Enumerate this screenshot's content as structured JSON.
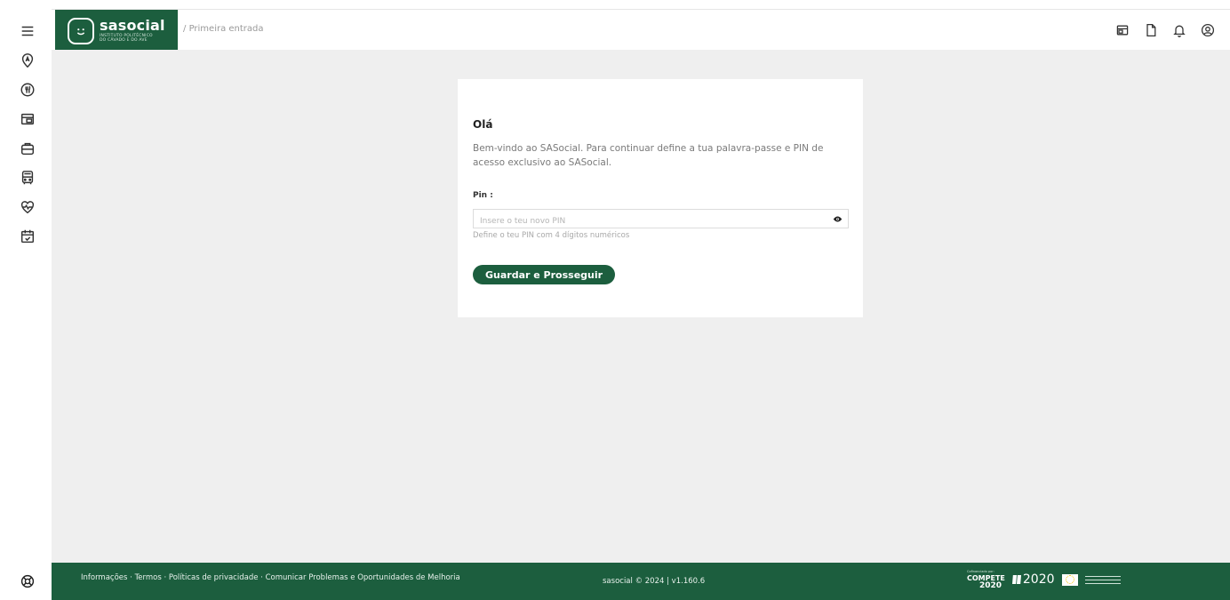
{
  "brand": {
    "name": "sasocial",
    "subtitle_line1": "INSTITUTO POLITÉCNICO",
    "subtitle_line2": "DO CÁVADO E DO AVE",
    "color": "#1c5e3e"
  },
  "breadcrumb": {
    "separator": "/",
    "current": "Primeira entrada"
  },
  "sidebar": {
    "items": [
      {
        "icon": "menu-icon"
      },
      {
        "icon": "accommodation-icon"
      },
      {
        "icon": "food-icon"
      },
      {
        "icon": "wallet-icon"
      },
      {
        "icon": "briefcase-icon"
      },
      {
        "icon": "bus-icon"
      },
      {
        "icon": "health-icon"
      },
      {
        "icon": "calendar-check-icon"
      }
    ]
  },
  "top_actions": [
    {
      "icon": "card-icon"
    },
    {
      "icon": "document-icon"
    },
    {
      "icon": "bell-icon"
    },
    {
      "icon": "user-circle-icon"
    }
  ],
  "card": {
    "title": "Olá",
    "text": "Bem-vindo ao SASocial. Para continuar define a tua palavra-passe e PIN de acesso exclusivo ao SASocial.",
    "pin_label": "Pin :",
    "pin_value": "",
    "pin_placeholder": "Insere o teu novo PIN",
    "pin_hint": "Define o teu PIN com 4 dígitos numéricos",
    "submit_label": "Guardar e Prosseguir"
  },
  "footer": {
    "links": [
      "Informações",
      "Termos",
      "Políticas de privacidade",
      "Comunicar Problemas e Oportunidades de Melhoria"
    ],
    "link_separator": " · ",
    "copyright": "sasocial © 2024 | v1.160.6",
    "logos": {
      "cofinanced_caption": "Cofinanciado por:",
      "compete": "COMPETE",
      "compete_year": "2020",
      "portugal2020": "2020"
    }
  }
}
